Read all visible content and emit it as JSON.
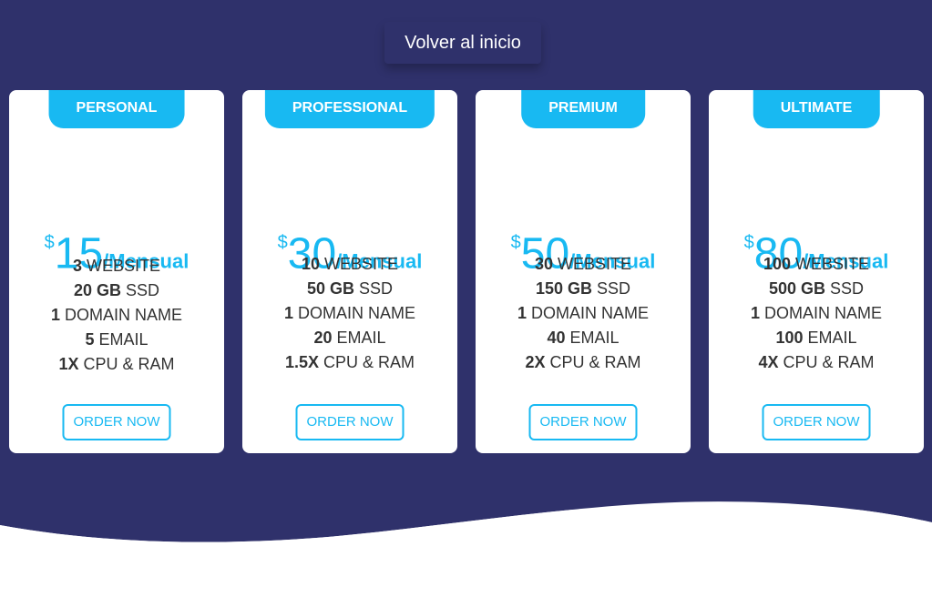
{
  "header": {
    "back_label": "Volver al inicio"
  },
  "colors": {
    "background": "#2f316b",
    "accent": "#18b9f2",
    "card": "#ffffff",
    "text": "#333333"
  },
  "plans": [
    {
      "name": "PERSONAL",
      "currency": "$",
      "price": "15",
      "period": "/Mensual",
      "features": [
        {
          "value": "3",
          "unit": "WEBSITE"
        },
        {
          "value": "20 GB",
          "unit": "SSD"
        },
        {
          "value": "1",
          "unit": "DOMAIN NAME"
        },
        {
          "value": "5",
          "unit": "EMAIL"
        },
        {
          "value": "1X",
          "unit": "CPU & RAM"
        }
      ],
      "button": "ORDER NOW"
    },
    {
      "name": "PROFESSIONAL",
      "currency": "$",
      "price": "30",
      "period": "/Mensual",
      "features": [
        {
          "value": "10",
          "unit": "WEBSITE"
        },
        {
          "value": "50 GB",
          "unit": "SSD"
        },
        {
          "value": "1",
          "unit": "DOMAIN NAME"
        },
        {
          "value": "20",
          "unit": "EMAIL"
        },
        {
          "value": "1.5X",
          "unit": "CPU & RAM"
        }
      ],
      "button": "ORDER NOW"
    },
    {
      "name": "PREMIUM",
      "currency": "$",
      "price": "50",
      "period": "/Mensual",
      "features": [
        {
          "value": "30",
          "unit": "WEBSITE"
        },
        {
          "value": "150 GB",
          "unit": "SSD"
        },
        {
          "value": "1",
          "unit": "DOMAIN NAME"
        },
        {
          "value": "40",
          "unit": "EMAIL"
        },
        {
          "value": "2X",
          "unit": "CPU & RAM"
        }
      ],
      "button": "ORDER NOW"
    },
    {
      "name": "ULTIMATE",
      "currency": "$",
      "price": "80",
      "period": "/Mensual",
      "features": [
        {
          "value": "100",
          "unit": "WEBSITE"
        },
        {
          "value": "500 GB",
          "unit": "SSD"
        },
        {
          "value": "1",
          "unit": "DOMAIN NAME"
        },
        {
          "value": "100",
          "unit": "EMAIL"
        },
        {
          "value": "4X",
          "unit": "CPU & RAM"
        }
      ],
      "button": "ORDER NOW"
    }
  ]
}
